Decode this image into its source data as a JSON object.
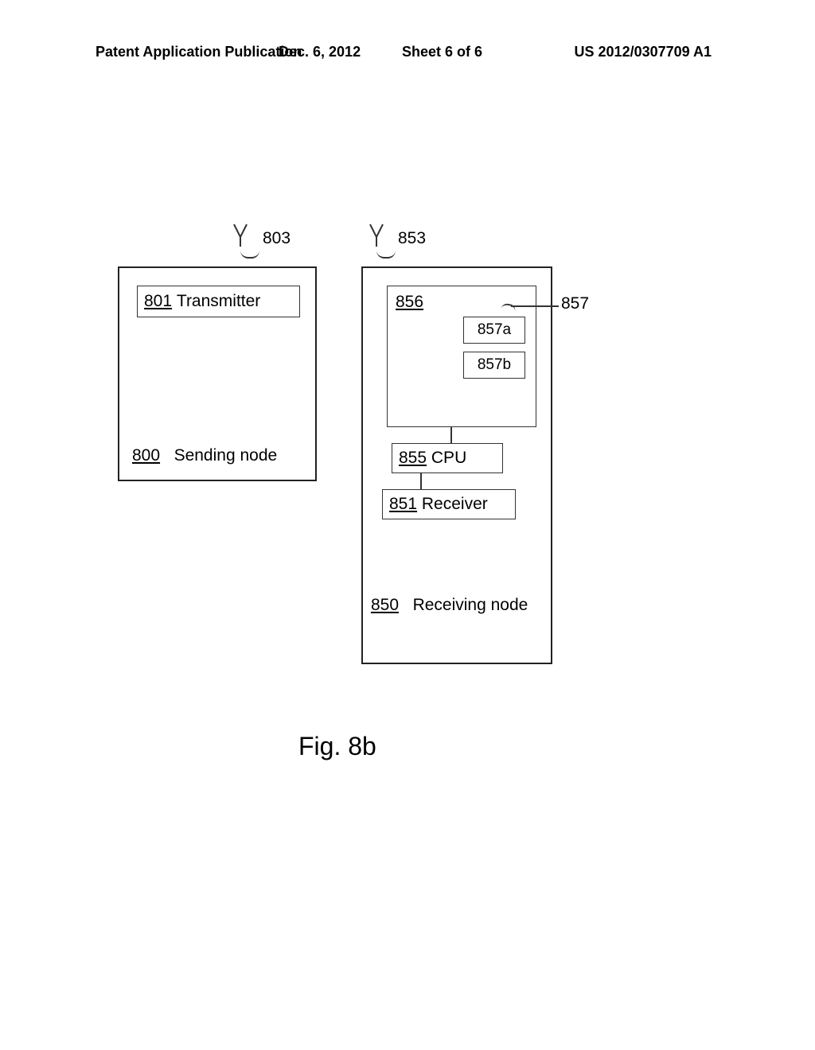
{
  "header": {
    "publication": "Patent Application Publication",
    "date": "Dec. 6, 2012",
    "sheet": "Sheet 6 of 6",
    "pub_number": "US 2012/0307709 A1"
  },
  "diagram": {
    "antenna_labels": {
      "left": "803",
      "right": "853"
    },
    "sending_node": {
      "transmitter_ref": "801",
      "transmitter_label": "Transmitter",
      "node_ref": "800",
      "node_label": "Sending node"
    },
    "receiving_node": {
      "box856_ref": "856",
      "lead857_label": "857",
      "sub_a": "857a",
      "sub_b": "857b",
      "cpu_ref": "855",
      "cpu_label": "CPU",
      "receiver_ref": "851",
      "receiver_label": "Receiver",
      "node_ref": "850",
      "node_label": "Receiving node"
    },
    "figure_label": "Fig. 8b"
  }
}
